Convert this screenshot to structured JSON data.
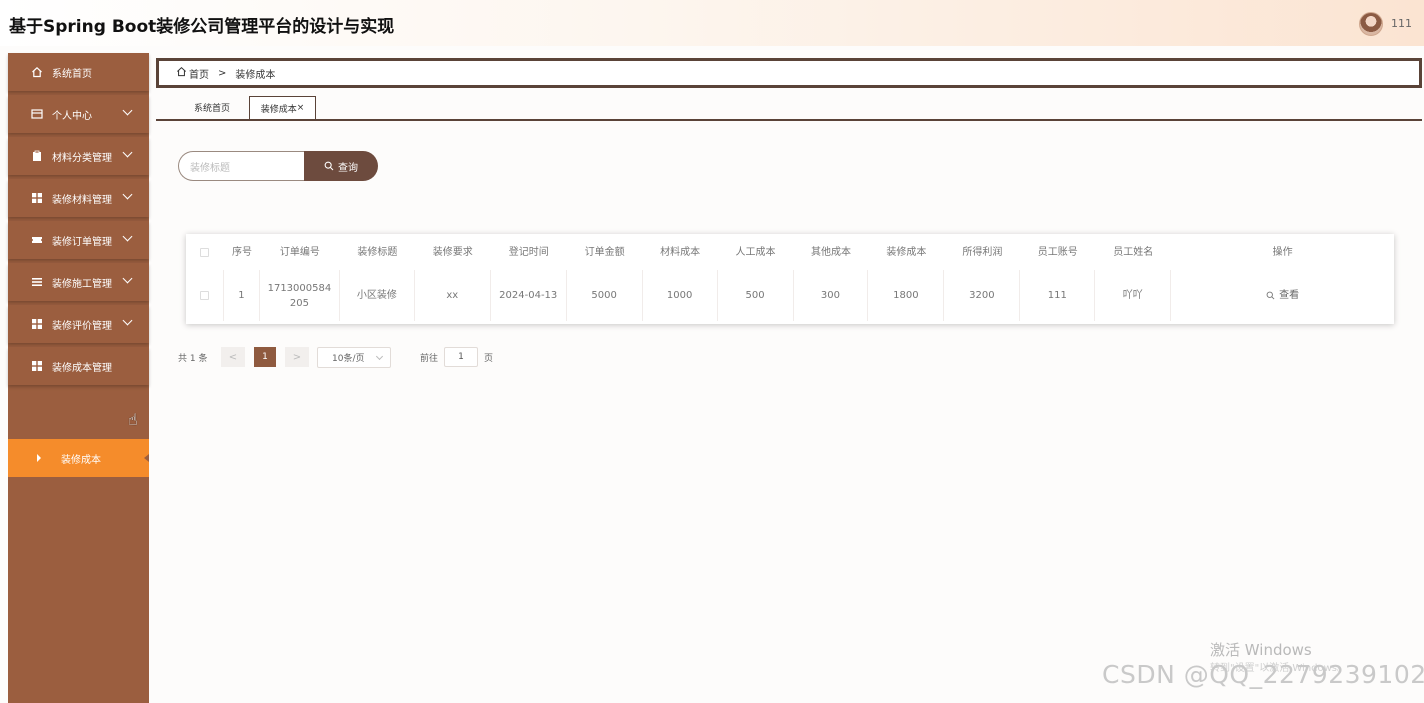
{
  "header": {
    "title": "基于Spring Boot装修公司管理平台的设计与实现",
    "user": "111"
  },
  "sidebar": {
    "items": [
      {
        "label": "系统首页",
        "icon": "home-icon"
      },
      {
        "label": "个人中心",
        "icon": "id-card-icon"
      },
      {
        "label": "材料分类管理",
        "icon": "clipboard-icon"
      },
      {
        "label": "装修材料管理",
        "icon": "grid-icon"
      },
      {
        "label": "装修订单管理",
        "icon": "ticket-icon"
      },
      {
        "label": "装修施工管理",
        "icon": "list-icon"
      },
      {
        "label": "装修评价管理",
        "icon": "grid-icon"
      },
      {
        "label": "装修成本管理",
        "icon": "grid-icon"
      }
    ],
    "active_sub": "装修成本"
  },
  "breadcrumb": {
    "home": "首页",
    "sep": ">",
    "current": "装修成本"
  },
  "tabs": {
    "home": "系统首页",
    "active": "装修成本",
    "close": "×"
  },
  "search": {
    "placeholder": "装修标题",
    "button": "查询"
  },
  "table": {
    "headers": [
      "序号",
      "订单编号",
      "装修标题",
      "装修要求",
      "登记时间",
      "订单金额",
      "材料成本",
      "人工成本",
      "其他成本",
      "装修成本",
      "所得利润",
      "员工账号",
      "员工姓名",
      "操作"
    ],
    "rows": [
      {
        "seq": "1",
        "order_no_1": "1713000584",
        "order_no_2": "205",
        "title": "小区装修",
        "req": "xx",
        "date": "2024-04-13",
        "amount": "5000",
        "material": "1000",
        "labor": "500",
        "other": "300",
        "cost": "1800",
        "profit": "3200",
        "emp_account": "111",
        "emp_name": "吖吖",
        "action": "查看"
      }
    ]
  },
  "pagination": {
    "total": "共 1 条",
    "prev": "<",
    "current": "1",
    "next": ">",
    "size": "10条/页",
    "goto_label": "前往",
    "goto_value": "1",
    "page_suffix": "页"
  },
  "watermark": {
    "win_line1": "激活 Windows",
    "win_line2": "转到\"设置\"以激活 Windows。",
    "csdn": "CSDN @QQ_2279239102"
  },
  "colors": {
    "sidebar": "#9b5e3f",
    "active_sub": "#f58c2b",
    "button": "#6d4b3e",
    "page_current": "#8f5a3f"
  }
}
